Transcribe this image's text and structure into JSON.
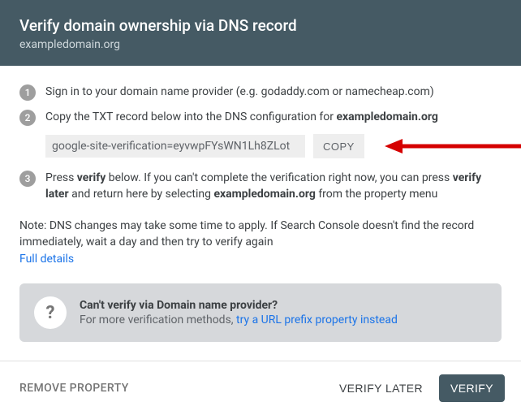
{
  "header": {
    "title": "Verify domain ownership via DNS record",
    "subtitle": "exampledomain.org"
  },
  "steps": {
    "s1": {
      "num": "1",
      "text": "Sign in to your domain name provider (e.g. godaddy.com or namecheap.com)"
    },
    "s2": {
      "num": "2",
      "prefix": "Copy the TXT record below into the DNS configuration for ",
      "domain": "exampledomain.org",
      "txt_record": "google-site-verification=eyvwpFYsWN1Lh8ZLot",
      "copy_label": "COPY"
    },
    "s3": {
      "num": "3",
      "p1": "Press ",
      "b1": "verify",
      "p2": " below. If you can't complete the verification right now, you can press ",
      "b2": "verify later",
      "p3": " and return here by selecting ",
      "b3": "exampledomain.org",
      "p4": " from the property menu"
    }
  },
  "note": {
    "text": "Note: DNS changes may take some time to apply. If Search Console doesn't find the record immediately, wait a day and then try to verify again",
    "link": "Full details"
  },
  "info": {
    "icon": "?",
    "title": "Can't verify via Domain name provider?",
    "sub_prefix": "For more verification methods, ",
    "sub_link": "try a URL prefix property instead"
  },
  "footer": {
    "remove": "REMOVE PROPERTY",
    "later": "VERIFY LATER",
    "verify": "VERIFY"
  }
}
